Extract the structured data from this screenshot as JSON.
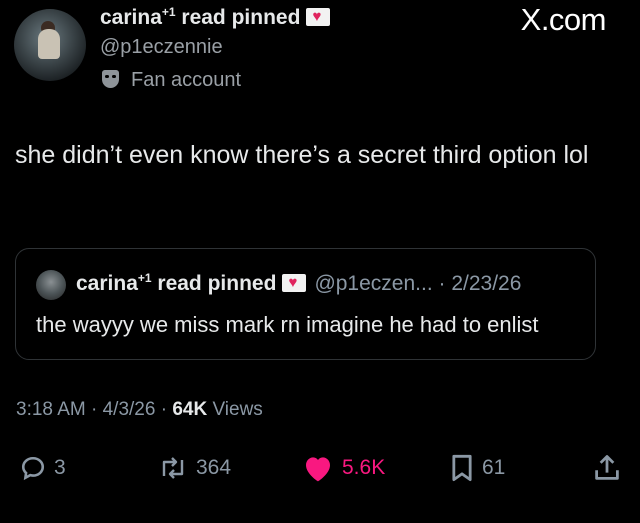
{
  "site": "X.com",
  "author": {
    "name": "carina",
    "name_sup": "+1",
    "name_suffix": "read pinned",
    "handle": "@p1eczennie",
    "label": "Fan account"
  },
  "tweet": {
    "text": "she didn’t even know there’s a secret third option lol"
  },
  "quote": {
    "name": "carina",
    "name_sup": "+1",
    "name_suffix": "read pinned",
    "handle_date": "@p1eczen... · 2/23/26",
    "text": "the wayyy we miss mark rn imagine he had to enlist"
  },
  "meta": {
    "time_date": "3:18 AM · 4/3/26 · ",
    "views_count": "64K",
    "views_label": " Views"
  },
  "actions": {
    "replies": "3",
    "reposts": "364",
    "likes": "5.6K",
    "bookmarks": "61"
  },
  "colors": {
    "background": "#000000",
    "text": "#e7e9ea",
    "muted": "#8b98a5",
    "like": "#f91880"
  }
}
